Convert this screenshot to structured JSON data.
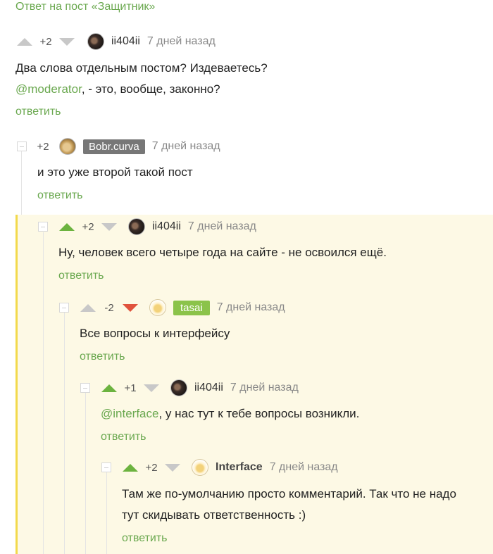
{
  "post_link": "Ответ на пост «Защитник»",
  "reply_label": "ответить",
  "comments": [
    {
      "rating": "+2",
      "user": "ii404ii",
      "time": "7 дней назад",
      "line1": "Два слова отдельным постом? Издеваетесь?",
      "mention": "@moderator",
      "line2_rest": ", - это, вообще, законно?"
    },
    {
      "rating": "+2",
      "user": "Bobr.curva",
      "time": "7 дней назад",
      "line1": "и это уже второй такой пост"
    },
    {
      "rating": "+2",
      "user": "ii404ii",
      "time": "7 дней назад",
      "line1": "Ну, человек всего четыре года на сайте - не освоился ещё."
    },
    {
      "rating": "-2",
      "user": "tasai",
      "time": "7 дней назад",
      "line1": "Все вопросы к интерфейсу"
    },
    {
      "rating": "+1",
      "user": "ii404ii",
      "time": "7 дней назад",
      "mention": "@interface",
      "line1_rest": ", у нас тут к тебе вопросы возникли."
    },
    {
      "rating": "+2",
      "user": "Interface",
      "time": "7 дней назад",
      "line1": "Там же по-умолчанию просто комментарий. Так что не надо",
      "line2": "тут скидывать ответственность :)"
    }
  ]
}
